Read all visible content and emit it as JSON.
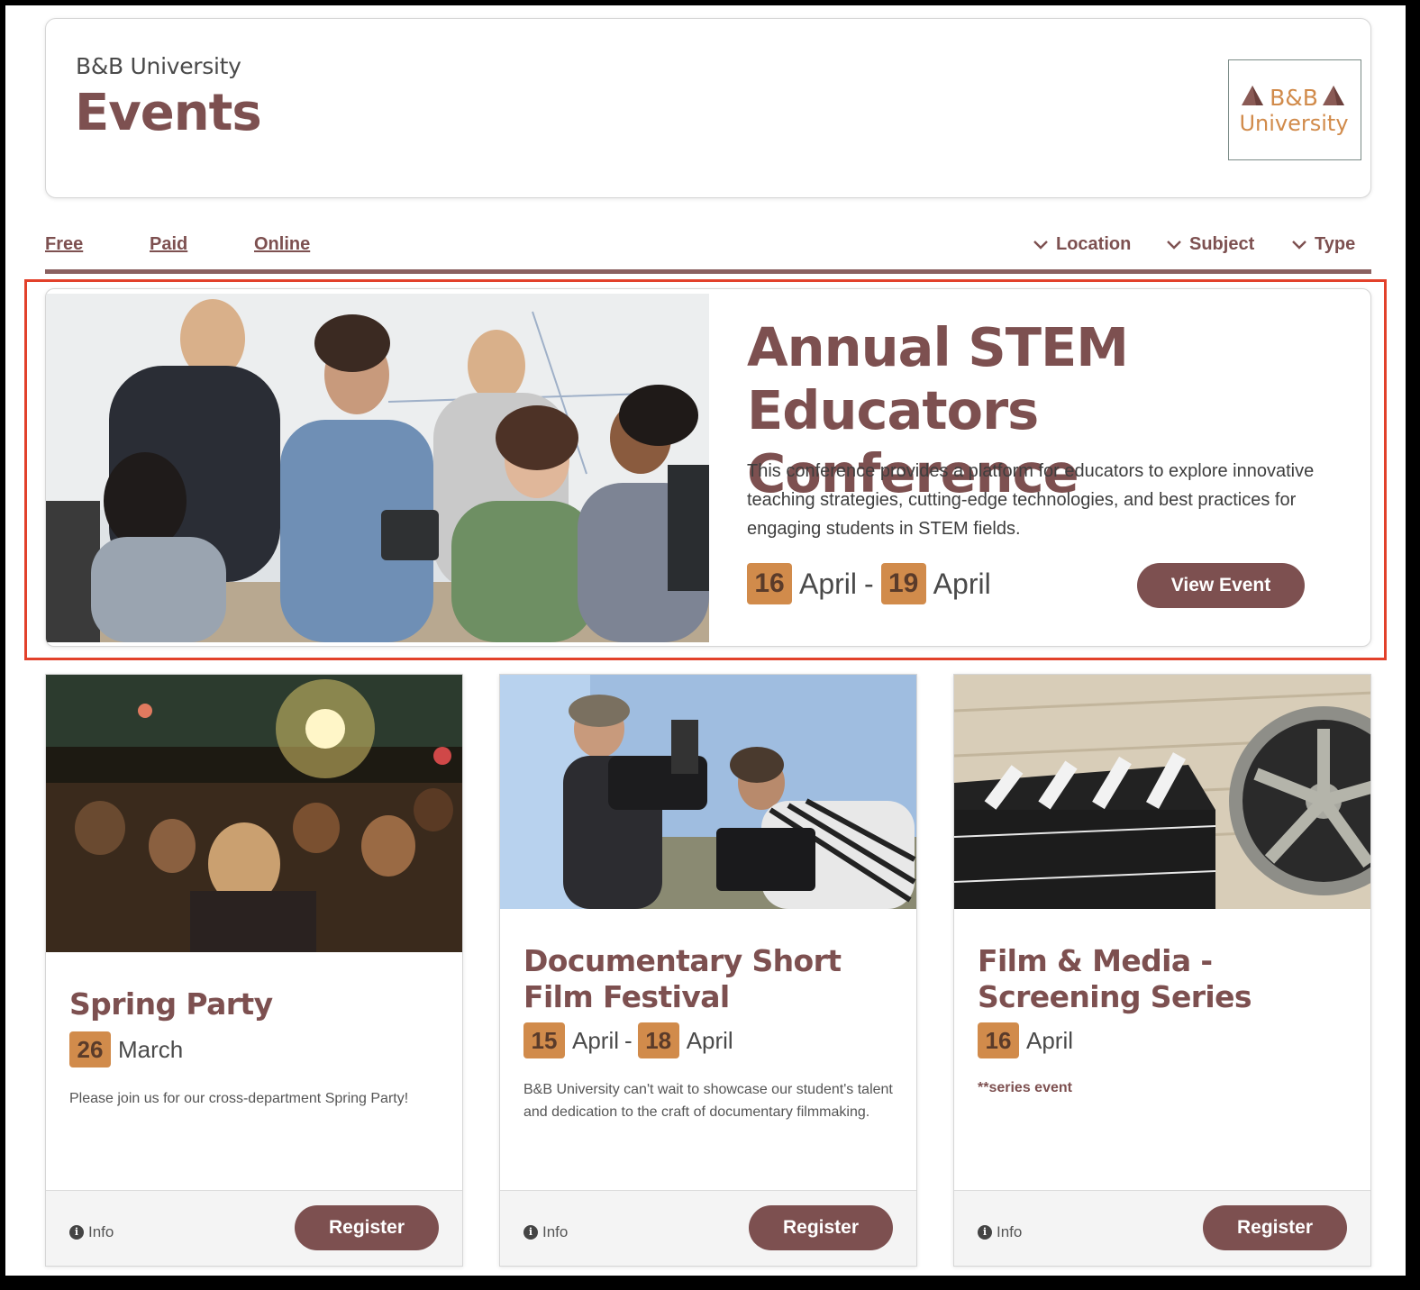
{
  "header": {
    "university": "B&B University",
    "title": "Events",
    "logo_line1": "B&B",
    "logo_line2": "University"
  },
  "filters": {
    "links": [
      "Free",
      "Paid",
      "Online"
    ],
    "dropdowns": [
      "Location",
      "Subject",
      "Type"
    ]
  },
  "featured": {
    "title_line1": "Annual STEM",
    "title_line2": "Educators Conference",
    "description": "This conference provides a platform for educators to explore innovative teaching strategies, cutting-edge technologies, and best practices for engaging students in STEM fields.",
    "start_day": "16",
    "start_month": "April",
    "separator": "-",
    "end_day": "19",
    "end_month": "April",
    "button": "View Event"
  },
  "cards": [
    {
      "title": "Spring Party",
      "start_day": "26",
      "start_month": "March",
      "description": "Please join us for our cross-department Spring Party!",
      "info": "Info",
      "button": "Register"
    },
    {
      "title": "Documentary Short Film Festival",
      "start_day": "15",
      "start_month": "April",
      "separator": "-",
      "end_day": "18",
      "end_month": "April",
      "description": "B&B University can't wait to showcase our student's talent and dedication to the craft of documentary filmmaking.",
      "info": "Info",
      "button": "Register"
    },
    {
      "title": "Film & Media - Screening Series",
      "start_day": "16",
      "start_month": "April",
      "note": "**series event",
      "info": "Info",
      "button": "Register"
    }
  ],
  "colors": {
    "brand": "#7d5050",
    "date_badge": "#d18b4b",
    "highlight": "#e2412b"
  }
}
